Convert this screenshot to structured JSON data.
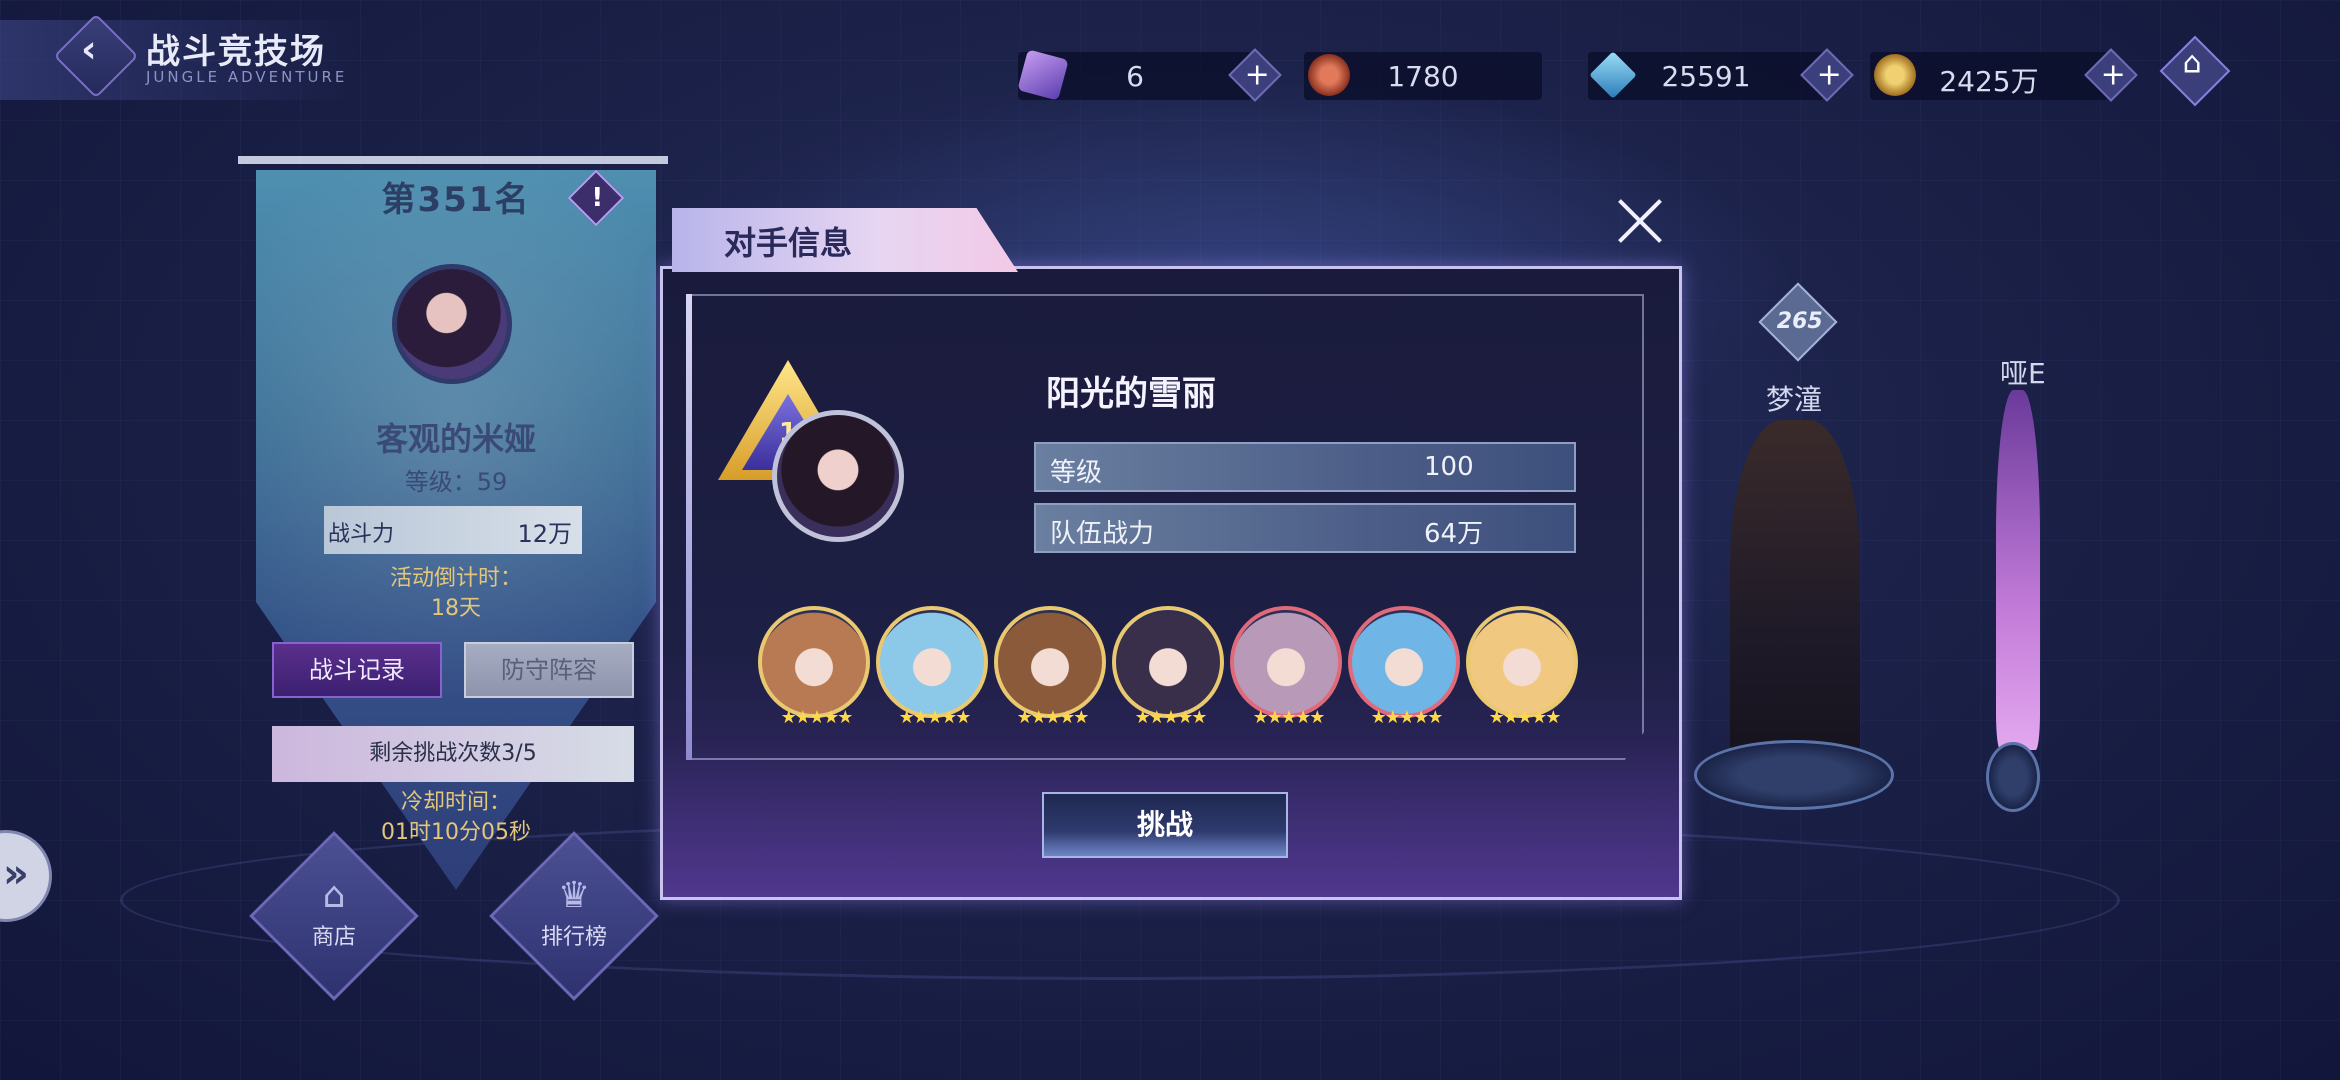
{
  "header": {
    "title": "战斗竞技场",
    "subtitle": "JUNGLE ADVENTURE"
  },
  "resources": [
    {
      "name": "purple-crystal",
      "value": "6",
      "color": "#8a6fe0"
    },
    {
      "name": "arena-coin",
      "value": "1780",
      "color": "#c0533a"
    },
    {
      "name": "diamond",
      "value": "25591",
      "color": "#47a6d8"
    },
    {
      "name": "gold",
      "value": "2425万",
      "color": "#c9a04a"
    }
  ],
  "profile": {
    "rank": "第351名",
    "name": "客观的米娅",
    "level": "等级：59",
    "power_label": "战斗力",
    "power_value": "12万",
    "countdown_label": "活动倒计时：",
    "countdown_value": "18天",
    "record_button": "战斗记录",
    "defense_button": "防守阵容",
    "remaining": "剩余挑战次数3/5",
    "cooldown_label": "冷却时间：",
    "cooldown_value": "01时10分05秒"
  },
  "bottom_buttons": {
    "shop_label": "商店",
    "rank_label": "排行榜"
  },
  "background_characters": [
    {
      "rank": "265",
      "name": "梦潼"
    },
    {
      "name": "哑E"
    }
  ],
  "dialog": {
    "title": "对手信息",
    "badge_rank": "1",
    "opponent_name": "阳光的雪丽",
    "level_label": "等级",
    "level_value": "100",
    "power_label": "队伍战力",
    "power_value": "64万",
    "heroes": [
      {
        "name": "hero-1",
        "color": "#b77a52",
        "stars": "★★★★★"
      },
      {
        "name": "hero-2",
        "color": "#8cc8e8",
        "stars": "★★★★★"
      },
      {
        "name": "hero-3",
        "color": "#8a5a3a",
        "stars": "★★★★★"
      },
      {
        "name": "hero-4",
        "color": "#3a2f4a",
        "stars": "★★★★★"
      },
      {
        "name": "hero-5",
        "color": "#b89ab8",
        "stars": "★★★★★"
      },
      {
        "name": "hero-6",
        "color": "#6fb6e6",
        "stars": "★★★★★"
      },
      {
        "name": "hero-7",
        "color": "#f0c880",
        "stars": "★★★★★"
      }
    ],
    "challenge_button": "挑战"
  }
}
